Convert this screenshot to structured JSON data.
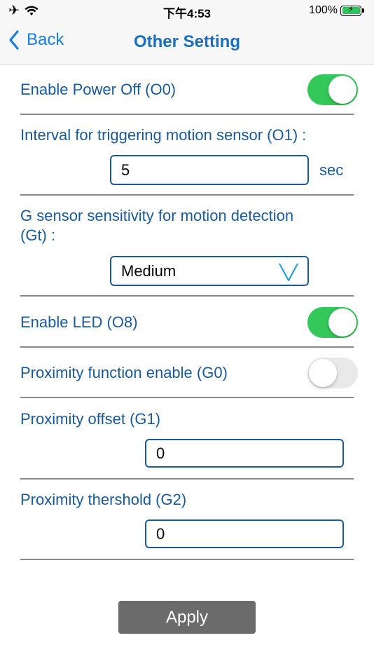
{
  "status_bar": {
    "time": "下午4:53",
    "battery": "100%",
    "icons": [
      "airplane-icon",
      "wifi-icon",
      "battery-charging-icon"
    ]
  },
  "nav": {
    "back_label": "Back",
    "title": "Other Setting"
  },
  "settings": {
    "power_off": {
      "label": "Enable Power Off (O0)",
      "enabled": true
    },
    "interval": {
      "label": "Interval for triggering motion sensor (O1) :",
      "value": "5",
      "unit": "sec"
    },
    "g_sensor": {
      "label_line1": "G sensor sensitivity for motion detection",
      "label_line2": "(Gt) :",
      "selected": "Medium"
    },
    "led": {
      "label": "Enable LED (O8)",
      "enabled": true
    },
    "proximity_enable": {
      "label": "Proximity function enable  (G0)",
      "enabled": false
    },
    "proximity_offset": {
      "label": "Proximity offset  (G1)",
      "value": "0"
    },
    "proximity_threshold": {
      "label": "Proximity thershold  (G2)",
      "value": "0"
    }
  },
  "apply_label": "Apply",
  "colors": {
    "accent": "#1a5a9a",
    "toggle_on": "#34c759",
    "toggle_off": "#e9e9ea",
    "apply_bg": "#6b6b6b"
  }
}
